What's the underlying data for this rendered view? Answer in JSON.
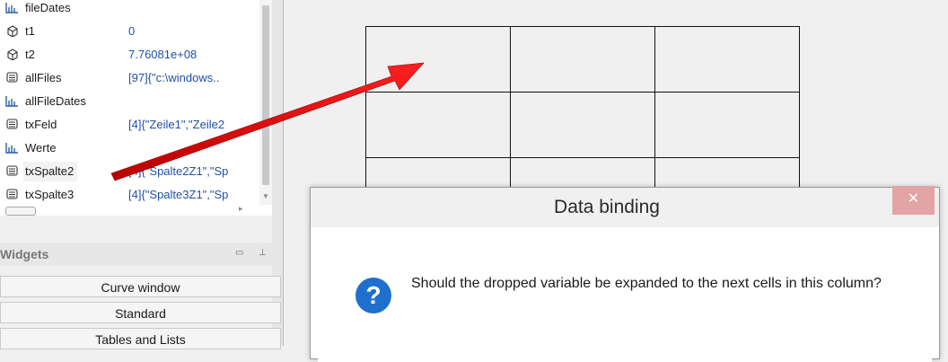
{
  "variables": [
    {
      "name": "fileDates",
      "value": "",
      "icon": "array-chart-icon"
    },
    {
      "name": "t1",
      "value": "0",
      "icon": "cube-icon"
    },
    {
      "name": "t2",
      "value": "7.76081e+08",
      "icon": "cube-icon"
    },
    {
      "name": "allFiles",
      "value": "[97]{\"c:\\windows..",
      "icon": "list-icon"
    },
    {
      "name": "allFileDates",
      "value": "",
      "icon": "array-chart-icon"
    },
    {
      "name": "txFeld",
      "value": "[4]{\"Zeile1\",\"Zeile2",
      "icon": "list-icon"
    },
    {
      "name": "Werte",
      "value": "",
      "icon": "array-chart-icon"
    },
    {
      "name": "txSpalte2",
      "value": "[4]{\"Spalte2Z1\",\"Sp",
      "icon": "list-icon"
    },
    {
      "name": "txSpalte3",
      "value": "[4]{\"Spalte3Z1\",\"Sp",
      "icon": "list-icon"
    }
  ],
  "widgets": {
    "title": "Widgets",
    "buttons": [
      "Curve window",
      "Standard",
      "Tables and Lists"
    ]
  },
  "dialog": {
    "title": "Data binding",
    "close_label": "✕",
    "message": "Should the dropped variable be expanded to the next cells in this column?",
    "icon_glyph": "?"
  },
  "colors": {
    "arrow": "#ee1111",
    "value_text": "#2050a8",
    "question_icon": "#1f6fcf",
    "close_button": "#e2a4a4"
  }
}
